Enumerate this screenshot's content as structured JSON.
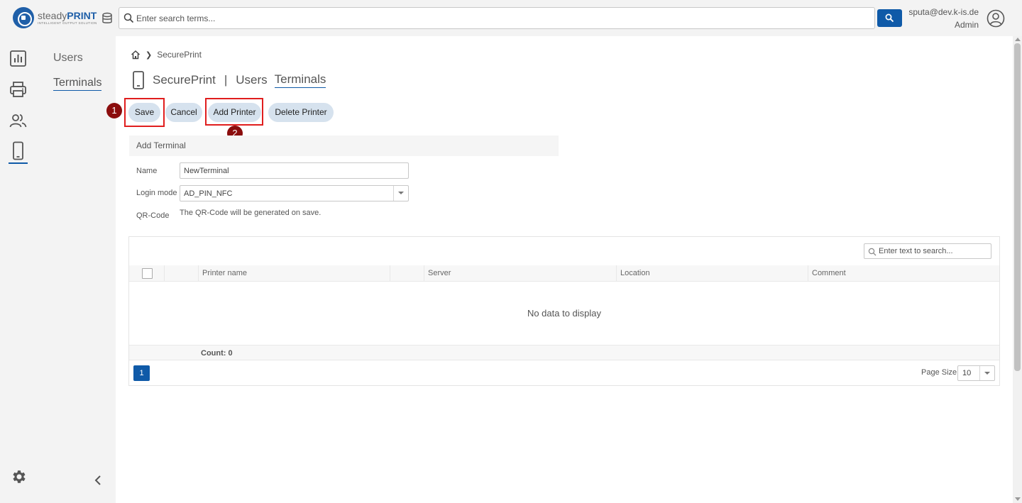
{
  "app": {
    "logo_steady": "steady",
    "logo_print": "PRINT",
    "logo_tagline": "INTELLIGENT OUTPUT SOLUTION"
  },
  "header": {
    "search_placeholder": "Enter search terms...",
    "user_email": "sputa@dev.k-is.de",
    "user_role": "Admin"
  },
  "subnav": {
    "items": [
      {
        "label": "Users"
      },
      {
        "label": "Terminals"
      }
    ]
  },
  "breadcrumb": {
    "current": "SecurePrint"
  },
  "title": {
    "part1": "SecurePrint",
    "separator": "|",
    "part2": "Users",
    "part3": "Terminals"
  },
  "toolbar": {
    "save": "Save",
    "cancel": "Cancel",
    "add_printer": "Add Printer",
    "delete_printer": "Delete Printer"
  },
  "markers": {
    "one": "1",
    "two": "2"
  },
  "form": {
    "section_title": "Add Terminal",
    "name_label": "Name",
    "name_value": "NewTerminal",
    "login_mode_label": "Login mode",
    "login_mode_value": "AD_PIN_NFC",
    "qr_label": "QR-Code",
    "qr_note": "The QR-Code will be generated on save."
  },
  "grid": {
    "search_placeholder": "Enter text to search...",
    "columns": [
      "Printer name",
      "Server",
      "Location",
      "Comment"
    ],
    "empty_text": "No data to display",
    "count": "Count: 0",
    "page": "1",
    "page_size_label": "Page Size:",
    "page_size": "10"
  },
  "colors": {
    "accent": "#0f5aa8",
    "pill": "#d6e2ee",
    "highlight": "#e01e1e",
    "marker": "#8b0d0d"
  }
}
